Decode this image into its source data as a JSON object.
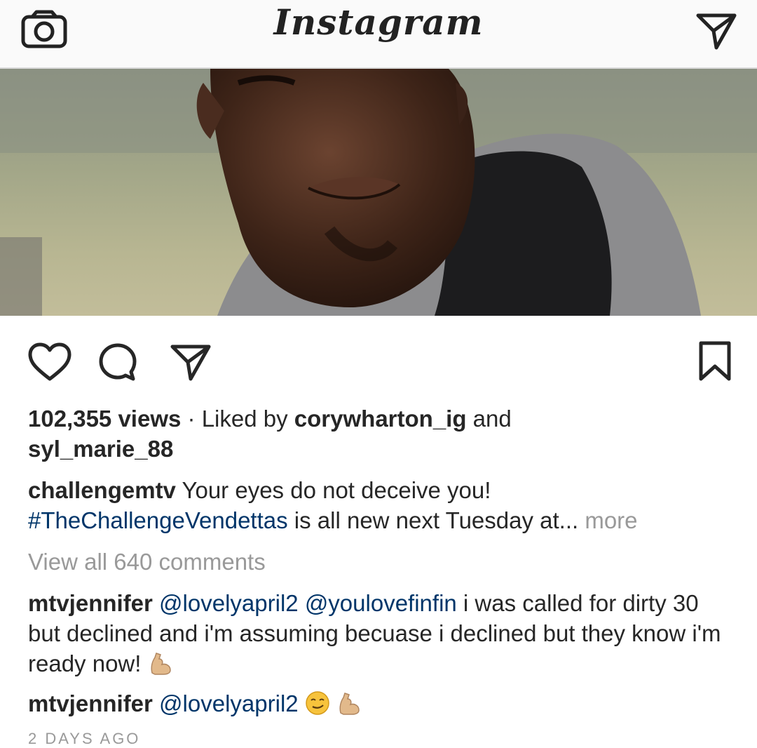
{
  "header": {
    "title": "Instagram",
    "left_icon": "camera-icon",
    "right_icon": "direct-message-icon"
  },
  "post": {
    "image_description_icon": "post-photo",
    "actions": {
      "like_icon": "heart-icon",
      "comment_icon": "comment-icon",
      "share_icon": "share-icon",
      "save_icon": "bookmark-icon"
    },
    "views": "102,355 views",
    "separator": " · ",
    "liked_by_prefix": "Liked by ",
    "liked_user_1": "corywharton_ig",
    "liked_and": " and",
    "liked_user_2": "syl_marie_88",
    "caption_user": "challengemtv",
    "caption_text_1": " Your eyes do not deceive you!",
    "caption_hashtag": "#TheChallengeVendettas",
    "caption_text_2": " is all new next Tuesday at...",
    "caption_more": " more",
    "view_all": "View all 640 comments",
    "comments": [
      {
        "user": "mtvjennifer",
        "mention_1": "@lovelyapril2",
        "mention_2": "@youlovefinfin",
        "text": " i was called for dirty 30 but declined and i'm assuming becuase i declined but they know i'm ready now!",
        "emoji": "flexed-biceps-icon"
      },
      {
        "user": "mtvjennifer",
        "mention_1": "@lovelyapril2",
        "emoji_1": "smirking-face-icon",
        "emoji_2": "flexed-biceps-icon"
      }
    ],
    "timestamp": "2 DAYS AGO"
  },
  "colors": {
    "link": "#003569",
    "secondary": "#999999",
    "text": "#262626",
    "border": "#dbdbdb"
  }
}
